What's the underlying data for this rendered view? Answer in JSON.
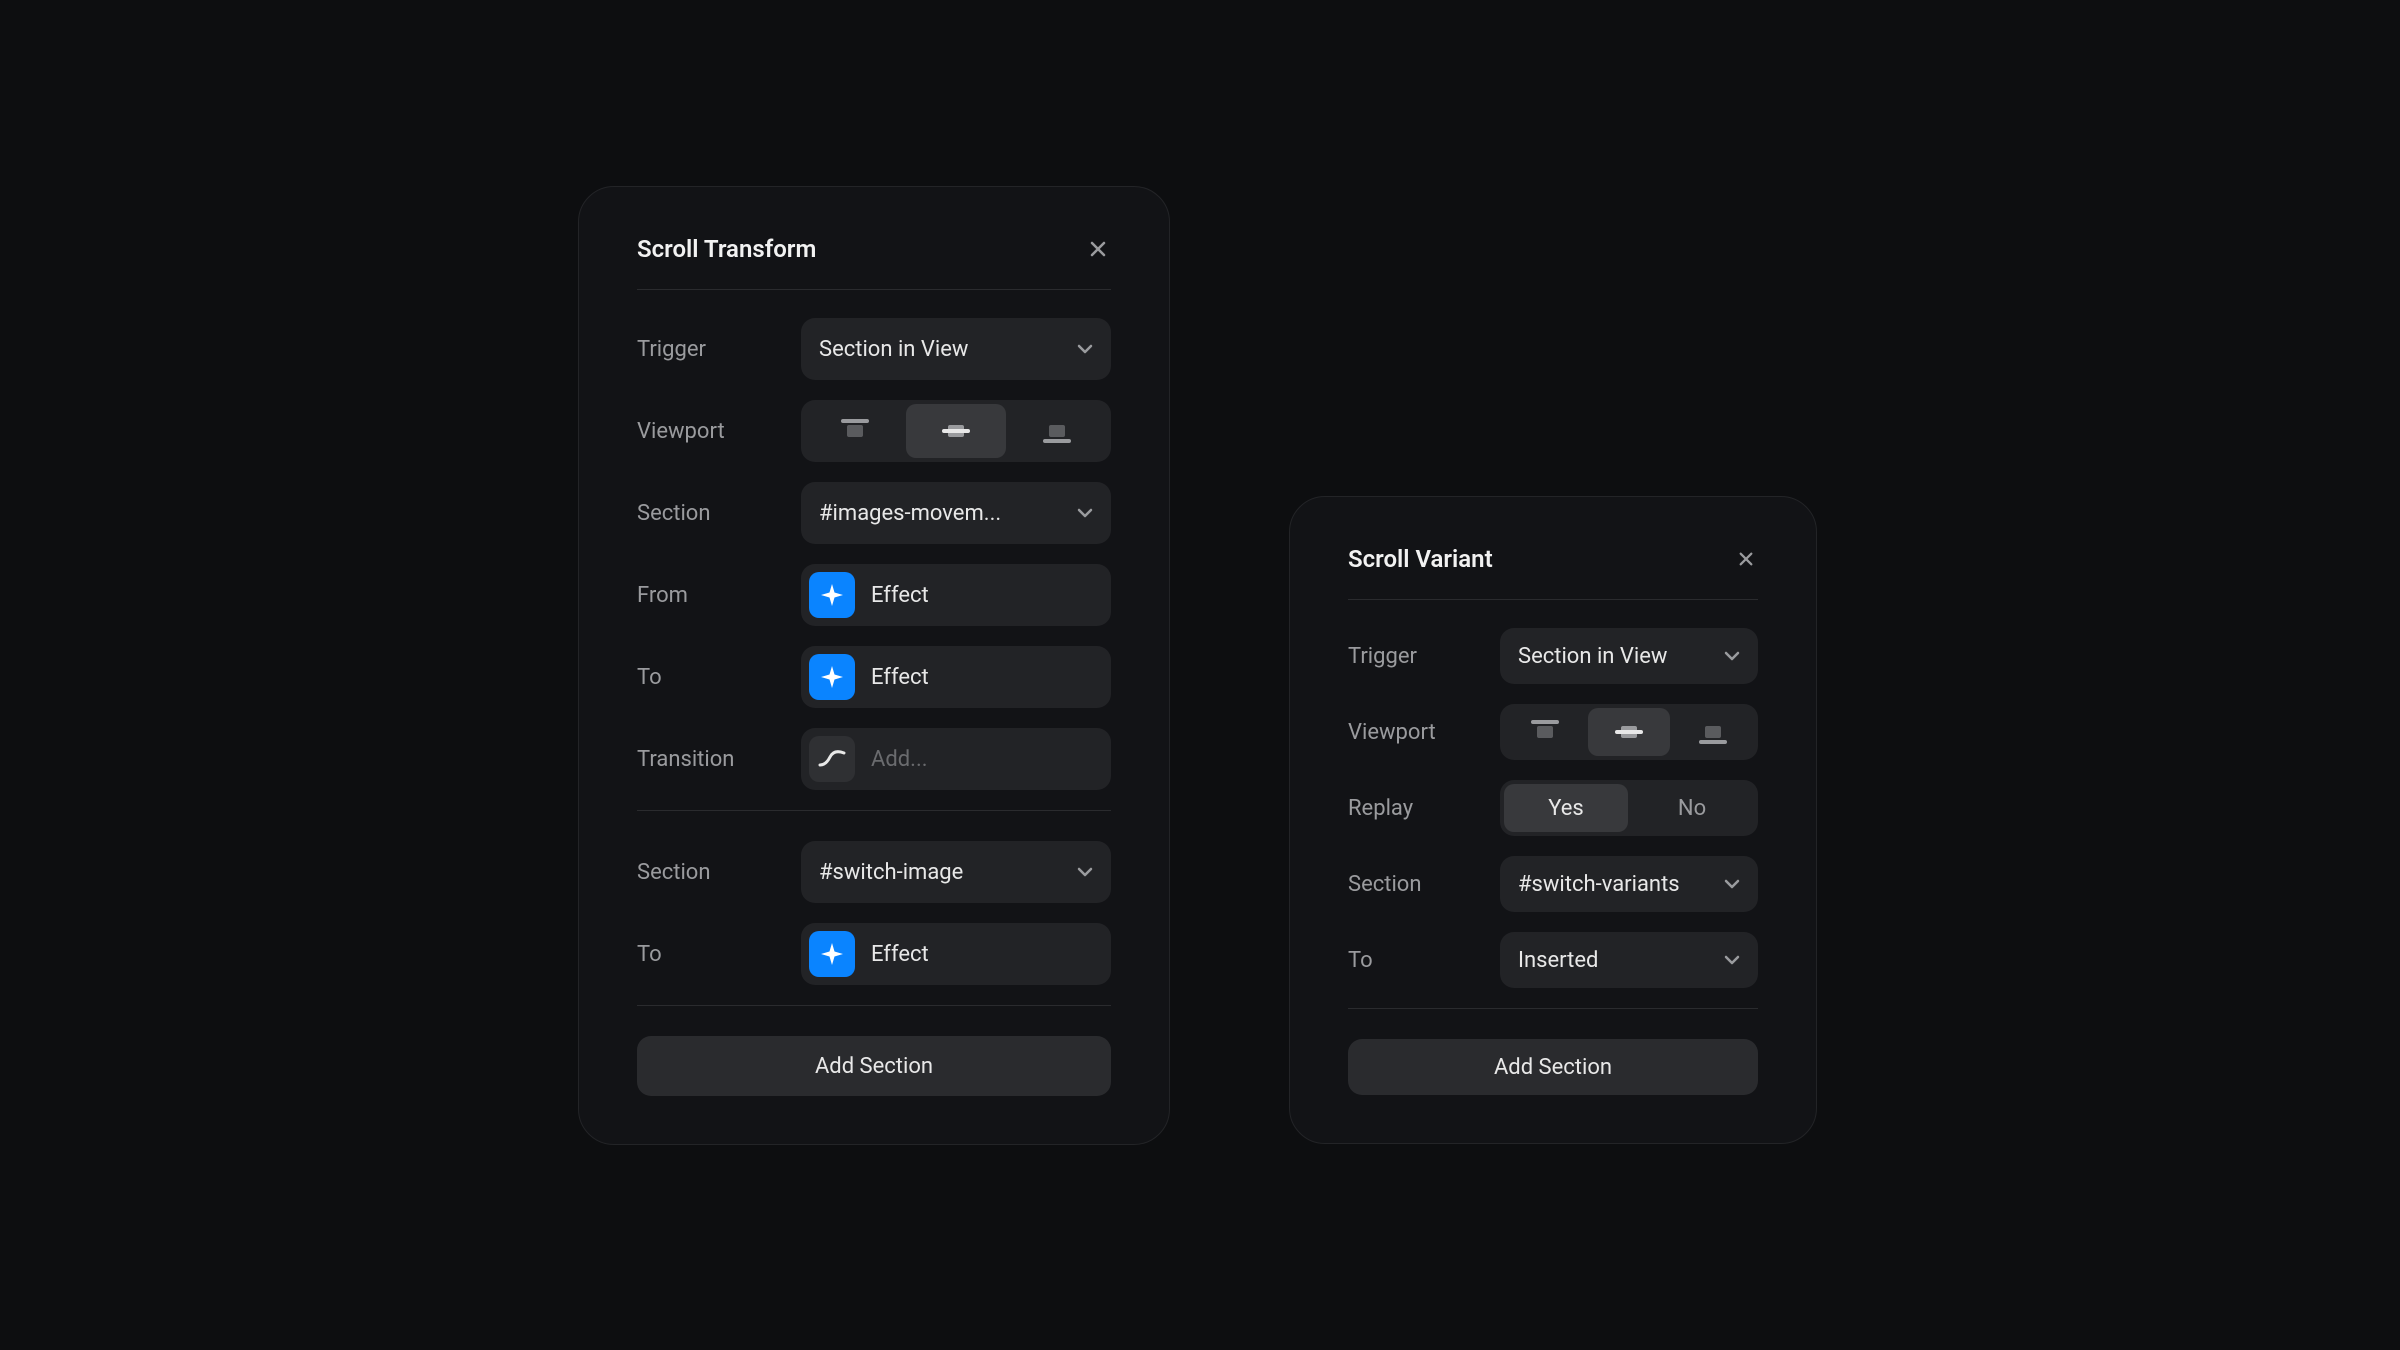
{
  "panel1": {
    "title": "Scroll Transform",
    "trigger": {
      "label": "Trigger",
      "value": "Section in View"
    },
    "viewport": {
      "label": "Viewport",
      "selected": "middle"
    },
    "section1": {
      "label": "Section",
      "value": "#images-movem..."
    },
    "from": {
      "label": "From",
      "value": "Effect"
    },
    "to1": {
      "label": "To",
      "value": "Effect"
    },
    "transition": {
      "label": "Transition",
      "placeholder": "Add..."
    },
    "section2": {
      "label": "Section",
      "value": "#switch-image"
    },
    "to2": {
      "label": "To",
      "value": "Effect"
    },
    "add": "Add Section"
  },
  "panel2": {
    "title": "Scroll Variant",
    "trigger": {
      "label": "Trigger",
      "value": "Section in View"
    },
    "viewport": {
      "label": "Viewport",
      "selected": "middle"
    },
    "replay": {
      "label": "Replay",
      "yes": "Yes",
      "no": "No",
      "selected": "yes"
    },
    "section": {
      "label": "Section",
      "value": "#switch-variants"
    },
    "to": {
      "label": "To",
      "value": "Inserted"
    },
    "add": "Add Section"
  }
}
